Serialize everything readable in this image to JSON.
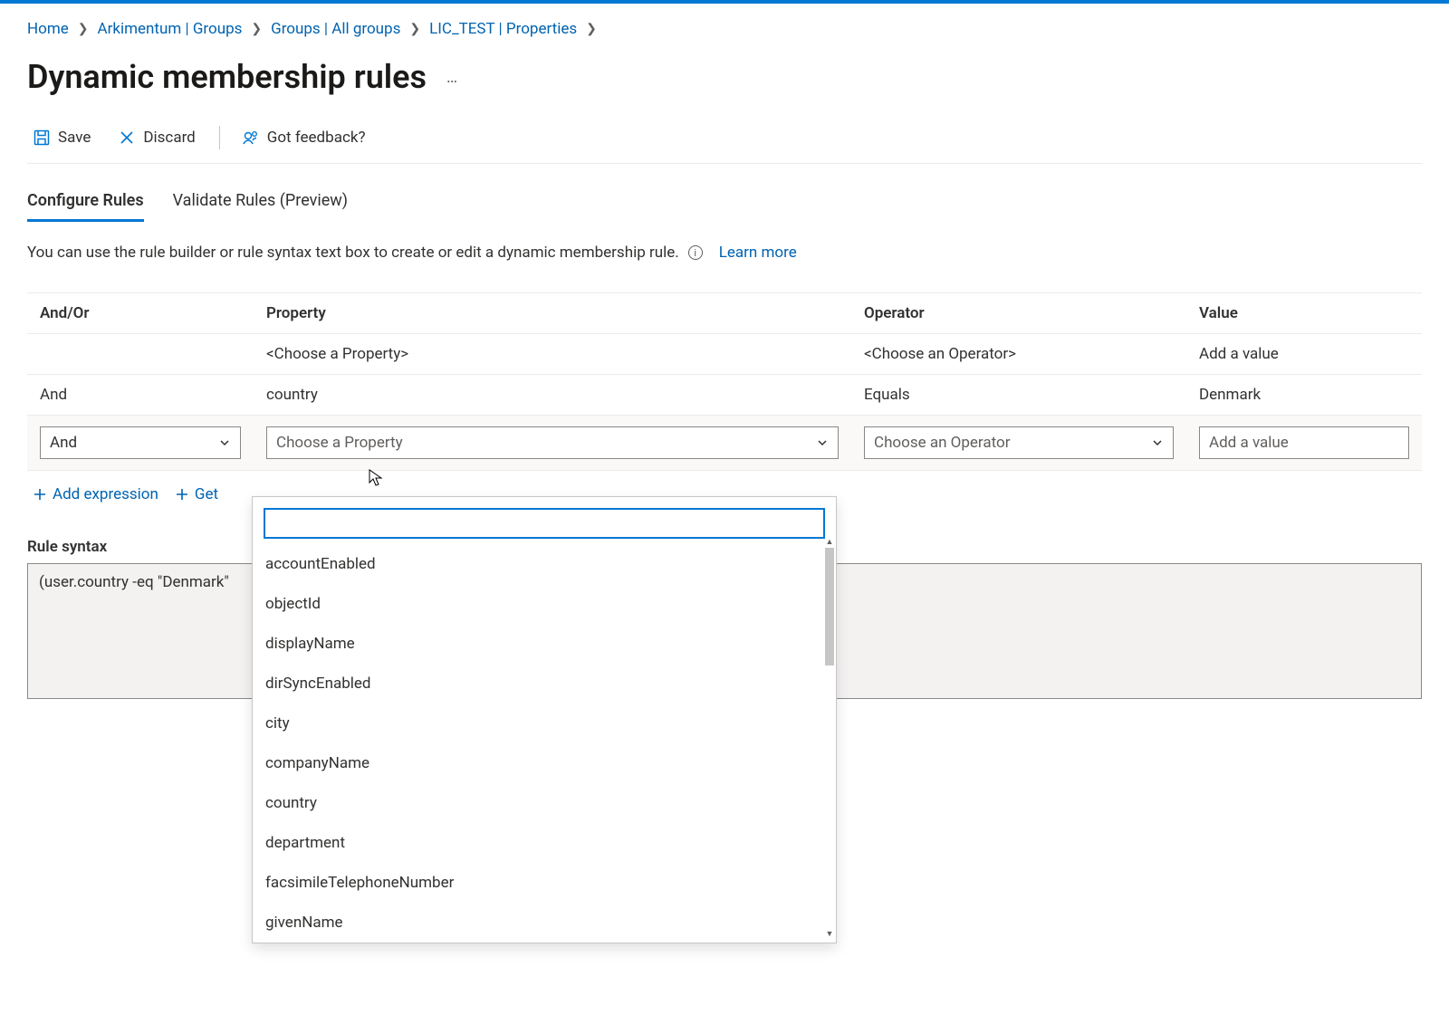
{
  "breadcrumb": {
    "items": [
      {
        "label": "Home"
      },
      {
        "label": "Arkimentum | Groups"
      },
      {
        "label": "Groups | All groups"
      },
      {
        "label": "LIC_TEST | Properties"
      }
    ]
  },
  "header": {
    "title": "Dynamic membership rules",
    "more": "…"
  },
  "toolbar": {
    "save": "Save",
    "discard": "Discard",
    "feedback": "Got feedback?"
  },
  "tabs": {
    "configure": "Configure Rules",
    "validate": "Validate Rules (Preview)"
  },
  "description": {
    "text": "You can use the rule builder or rule syntax text box to create or edit a dynamic membership rule.",
    "learn_more": "Learn more"
  },
  "table": {
    "headers": {
      "andor": "And/Or",
      "property": "Property",
      "operator": "Operator",
      "value": "Value"
    },
    "rows": [
      {
        "andor": "",
        "property": "<Choose a Property>",
        "operator": "<Choose an Operator>",
        "value": "Add a value"
      },
      {
        "andor": "And",
        "property": "country",
        "operator": "Equals",
        "value": "Denmark"
      }
    ],
    "editing": {
      "andor": "And",
      "property_placeholder": "Choose a Property",
      "operator_placeholder": "Choose an Operator",
      "value_placeholder": "Add a value"
    }
  },
  "dropdown": {
    "search_placeholder": "",
    "items": [
      "accountEnabled",
      "objectId",
      "displayName",
      "dirSyncEnabled",
      "city",
      "companyName",
      "country",
      "department",
      "facsimileTelephoneNumber",
      "givenName"
    ]
  },
  "actions": {
    "add_expression": "Add expression",
    "get_custom": "Get"
  },
  "rule_syntax": {
    "label": "Rule syntax",
    "text": "(user.country -eq \"Denmark\""
  }
}
